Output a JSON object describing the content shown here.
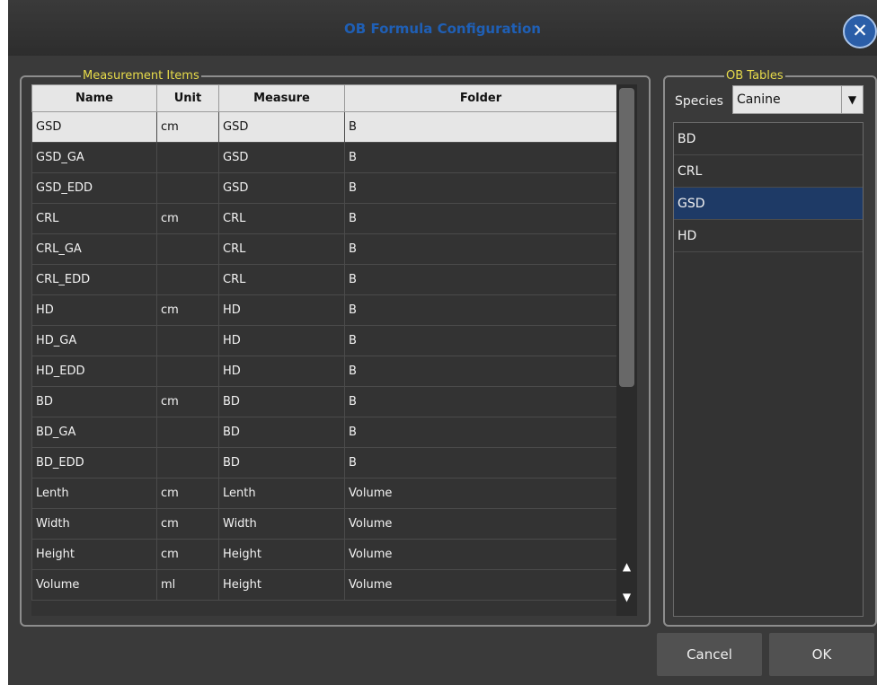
{
  "window": {
    "title": "OB Formula Configuration",
    "close_label": "✕"
  },
  "measurement_group": {
    "legend": "Measurement Items"
  },
  "table": {
    "columns": [
      "Name",
      "Unit",
      "Measure",
      "Folder"
    ],
    "rows": [
      [
        "GSD",
        "cm",
        "GSD",
        "B"
      ],
      [
        "GSD_GA",
        "",
        "GSD",
        "B"
      ],
      [
        "GSD_EDD",
        "",
        "GSD",
        "B"
      ],
      [
        "CRL",
        "cm",
        "CRL",
        "B"
      ],
      [
        "CRL_GA",
        "",
        "CRL",
        "B"
      ],
      [
        "CRL_EDD",
        "",
        "CRL",
        "B"
      ],
      [
        "HD",
        "cm",
        "HD",
        "B"
      ],
      [
        "HD_GA",
        "",
        "HD",
        "B"
      ],
      [
        "HD_EDD",
        "",
        "HD",
        "B"
      ],
      [
        "BD",
        "cm",
        "BD",
        "B"
      ],
      [
        "BD_GA",
        "",
        "BD",
        "B"
      ],
      [
        "BD_EDD",
        "",
        "BD",
        "B"
      ],
      [
        "Lenth",
        "cm",
        "Lenth",
        "Volume"
      ],
      [
        "Width",
        "cm",
        "Width",
        "Volume"
      ],
      [
        "Height",
        "cm",
        "Height",
        "Volume"
      ],
      [
        "Volume",
        "ml",
        "Height",
        "Volume"
      ]
    ],
    "selected_row": 0,
    "scroll_up_icon": "▲",
    "scroll_down_icon": "▼"
  },
  "ob_group": {
    "legend": "OB Tables",
    "species_label": "Species",
    "species_value": "Canine",
    "species_arrow": "▼",
    "items": [
      "BD",
      "CRL",
      "GSD",
      "HD"
    ],
    "selected_item": 2
  },
  "buttons": {
    "cancel_label": "Cancel",
    "ok_label": "OK"
  },
  "colors": {
    "title": "#1f5fb5",
    "legend": "#e8dc4a",
    "selection": "#1e3a66"
  }
}
